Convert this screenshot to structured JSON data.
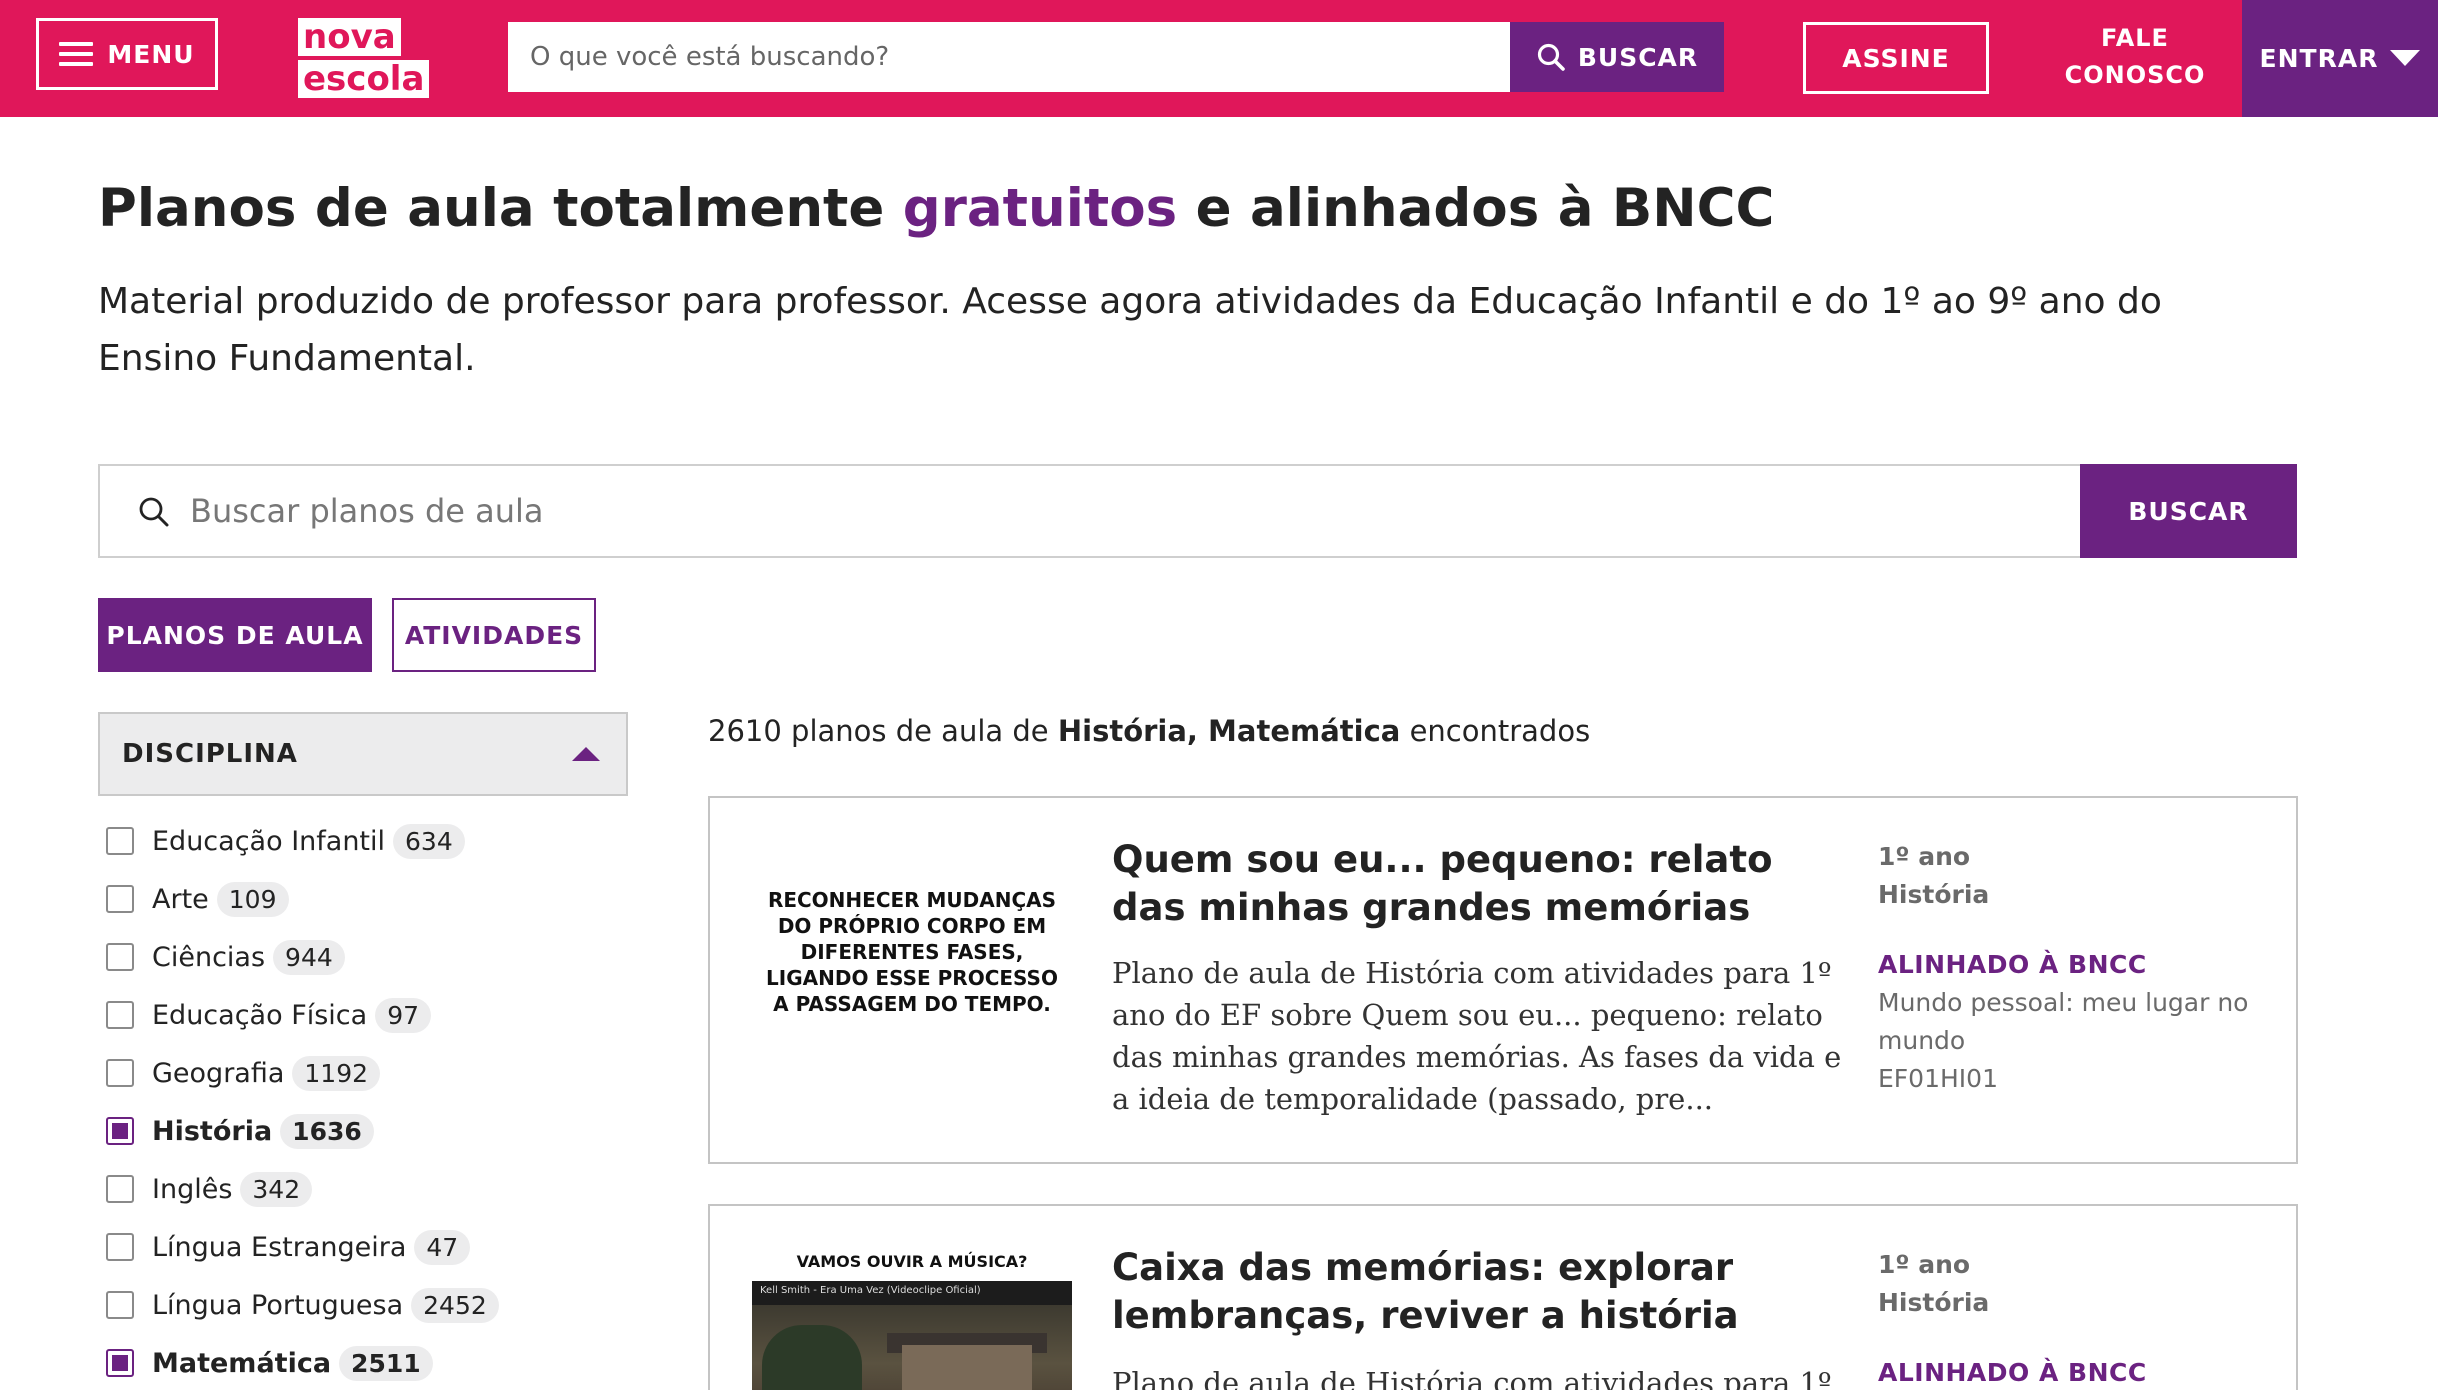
{
  "header": {
    "menu_label": "MENU",
    "logo_line1": "nova",
    "logo_line2": "escola",
    "search_placeholder": "O que você está buscando?",
    "search_button": "BUSCAR",
    "assine_label": "ASSINE",
    "fale_line1": "FALE",
    "fale_line2": "CONOSCO",
    "entrar_label": "ENTRAR"
  },
  "colors": {
    "brand_pink": "#e0175a",
    "brand_purple": "#6b2281"
  },
  "hero": {
    "title_prefix": "Planos de aula totalmente ",
    "title_highlight": "gratuitos",
    "title_suffix": " e alinhados à BNCC",
    "subtitle": "Material produzido de professor para professor. Acesse agora atividades da Educação Infantil e do 1º ao 9º ano do Ensino Fundamental."
  },
  "main_search": {
    "placeholder": "Buscar planos de aula",
    "button": "BUSCAR"
  },
  "tabs": {
    "planos": "PLANOS DE AULA",
    "atividades": "ATIVIDADES"
  },
  "filter": {
    "title": "DISCIPLINA",
    "items": [
      {
        "label": "Educação Infantil",
        "count": "634",
        "checked": false
      },
      {
        "label": "Arte",
        "count": "109",
        "checked": false
      },
      {
        "label": "Ciências",
        "count": "944",
        "checked": false
      },
      {
        "label": "Educação Física",
        "count": "97",
        "checked": false
      },
      {
        "label": "Geografia",
        "count": "1192",
        "checked": false
      },
      {
        "label": "História",
        "count": "1636",
        "checked": true
      },
      {
        "label": "Inglês",
        "count": "342",
        "checked": false
      },
      {
        "label": "Língua Estrangeira",
        "count": "47",
        "checked": false
      },
      {
        "label": "Língua Portuguesa",
        "count": "2452",
        "checked": false
      },
      {
        "label": "Matemática",
        "count": "2511",
        "checked": true
      }
    ]
  },
  "results": {
    "count": "2610",
    "text_mid": " planos de aula de ",
    "subjects": "História, Matemática",
    "text_end": " encontrados",
    "cards": [
      {
        "thumb_text": "RECONHECER MUDANÇAS DO PRÓPRIO CORPO EM DIFERENTES FASES, LIGANDO ESSE PROCESSO A PASSAGEM DO TEMPO.",
        "title": "Quem sou eu... pequeno: relato das minhas grandes memórias",
        "description": "Plano de aula de História com atividades para 1º ano do EF sobre Quem sou eu... pequeno: relato das minhas grandes memórias. As fases da vida e a ideia de temporalidade (passado, pre...",
        "grade": "1º ano",
        "subject": "História",
        "bncc_label": "ALINHADO À BNCC",
        "bncc_context": "Mundo pessoal: meu lugar no mundo",
        "bncc_code": "EF01HI01"
      },
      {
        "thumb_caption": "VAMOS OUVIR A MÚSICA?",
        "video_title": "Kell Smith - Era Uma Vez (Videoclipe Oficial)",
        "title": "Caixa das memórias: explorar lembranças, reviver a história",
        "description": "Plano de aula de História com atividades para 1º ano",
        "grade": "1º ano",
        "subject": "História",
        "bncc_label": "ALINHADO À BNCC"
      }
    ]
  }
}
